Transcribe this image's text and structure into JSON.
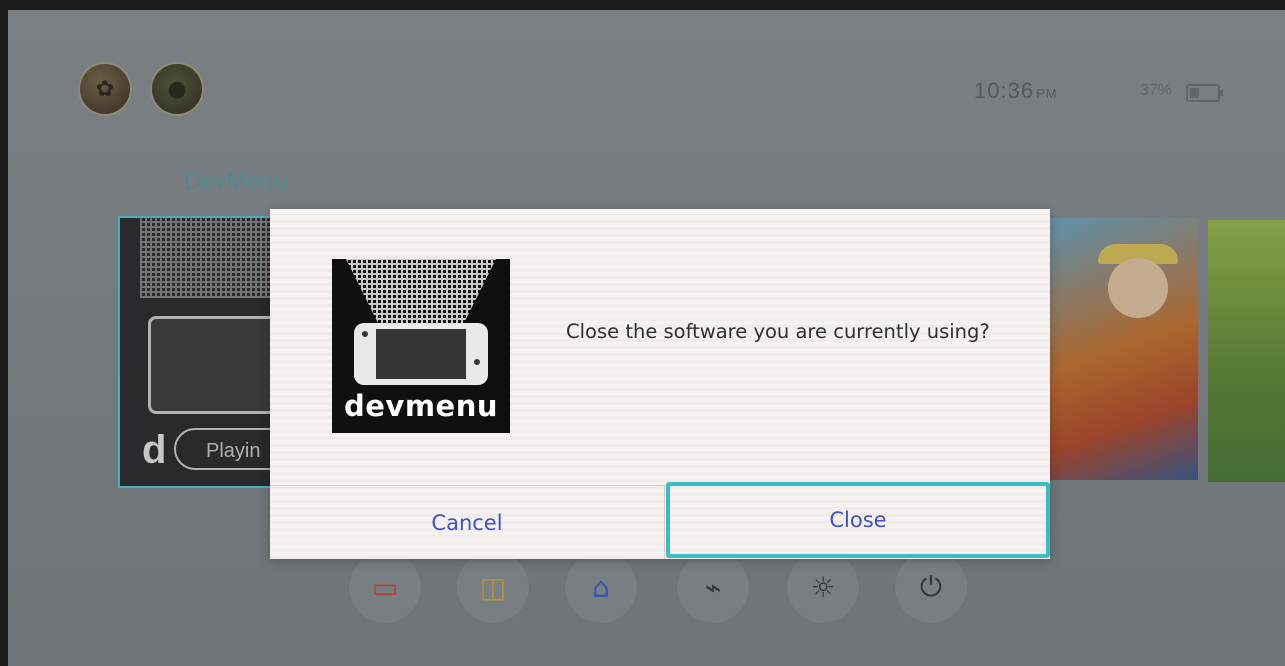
{
  "header": {
    "time": "10:36",
    "time_suffix": "PM",
    "battery": "37%"
  },
  "home": {
    "app_title": "DevMenu",
    "tiles": [
      {
        "name": "devmenu",
        "status": "Playin",
        "letter": "d"
      },
      {
        "name": "one-piece"
      },
      {
        "name": "green-game"
      }
    ],
    "dock_icons": [
      "news-icon",
      "shop-icon",
      "album-icon",
      "controllers-icon",
      "settings-icon",
      "power-icon"
    ]
  },
  "dialog": {
    "logo_text": "devmenu",
    "message": "Close the software you are currently using?",
    "cancel_label": "Cancel",
    "close_label": "Close"
  },
  "colors": {
    "accent": "#3bbcc7",
    "button_text": "#3f4fc6",
    "app_title": "#5a9fa6"
  }
}
